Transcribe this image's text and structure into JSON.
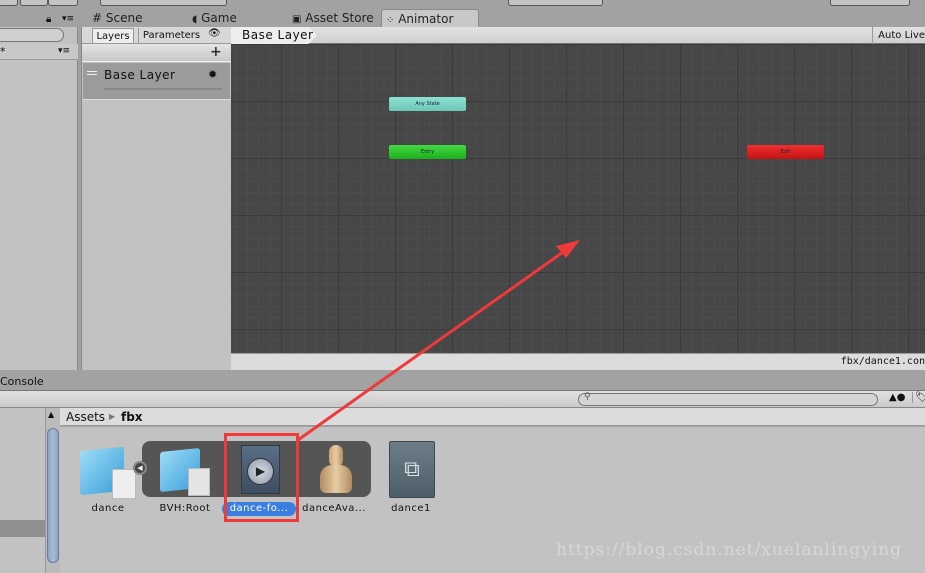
{
  "tabs": [
    {
      "label": "Scene",
      "icon": "grid-icon"
    },
    {
      "label": "Game",
      "icon": "pacman-icon"
    },
    {
      "label": "Asset Store",
      "icon": "bag-icon"
    },
    {
      "label": "Animator",
      "icon": "animator-icon",
      "active": true
    }
  ],
  "hierarchy": {
    "row_label": "*"
  },
  "animator": {
    "side_tabs": [
      "Layers",
      "Parameters"
    ],
    "add_label": "+",
    "layers": [
      {
        "name": "Base Layer"
      }
    ],
    "breadcrumb": "Base Layer",
    "auto_live": "Auto Live",
    "status_path": "fbx/dance1.con",
    "states": [
      {
        "name": "Any State",
        "color": "#7ed4c4"
      },
      {
        "name": "Entry",
        "color": "#2ec22e"
      },
      {
        "name": "Exit",
        "color": "#d81c1c"
      }
    ]
  },
  "console": {
    "tab_label": "Console"
  },
  "project": {
    "breadcrumb": [
      "Assets",
      "fbx"
    ],
    "search_placeholder": "",
    "assets": [
      {
        "label": "dance",
        "icon": "model-icon"
      },
      {
        "label": "BVH:Root",
        "icon": "model-icon"
      },
      {
        "label": "dance-fo...",
        "icon": "animation-clip-icon",
        "selected": true
      },
      {
        "label": "danceAva...",
        "icon": "avatar-icon"
      },
      {
        "label": "dance1",
        "icon": "animator-controller-icon"
      }
    ]
  },
  "annotation": {
    "color": "#f03a3a"
  },
  "watermark": "https://blog.csdn.net/xuelanlingying"
}
